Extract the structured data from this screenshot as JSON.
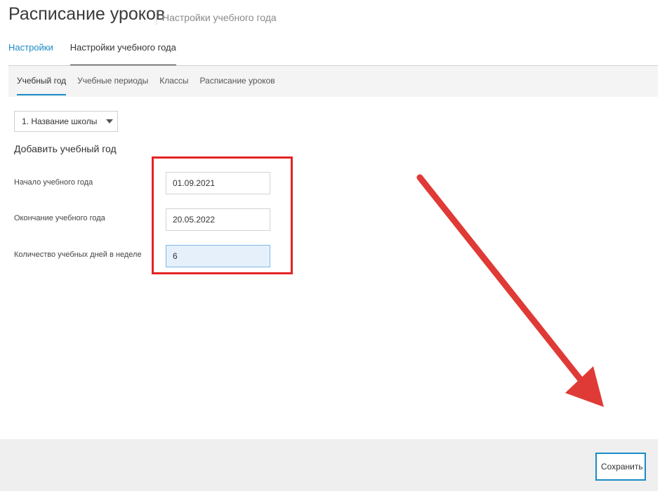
{
  "header": {
    "title": "Расписание уроков",
    "subtitle": "Настройки учебного года"
  },
  "top_tabs": [
    {
      "label": "Настройки"
    },
    {
      "label": "Настройки учебного года"
    }
  ],
  "sub_tabs": [
    {
      "label": "Учебный год"
    },
    {
      "label": "Учебные периоды"
    },
    {
      "label": "Классы"
    },
    {
      "label": "Расписание уроков"
    }
  ],
  "school_select": {
    "value": "1. Название школы"
  },
  "form": {
    "title": "Добавить учебный год",
    "fields": [
      {
        "label": "Начало учебного года",
        "value": "01.09.2021"
      },
      {
        "label": "Окончание учебного года",
        "value": "20.05.2022"
      },
      {
        "label": "Количество учебных дней в неделе",
        "value": "6"
      }
    ]
  },
  "footer": {
    "save_label": "Сохранить"
  },
  "colors": {
    "accent": "#1a8bc6",
    "annotation": "#e52424"
  }
}
